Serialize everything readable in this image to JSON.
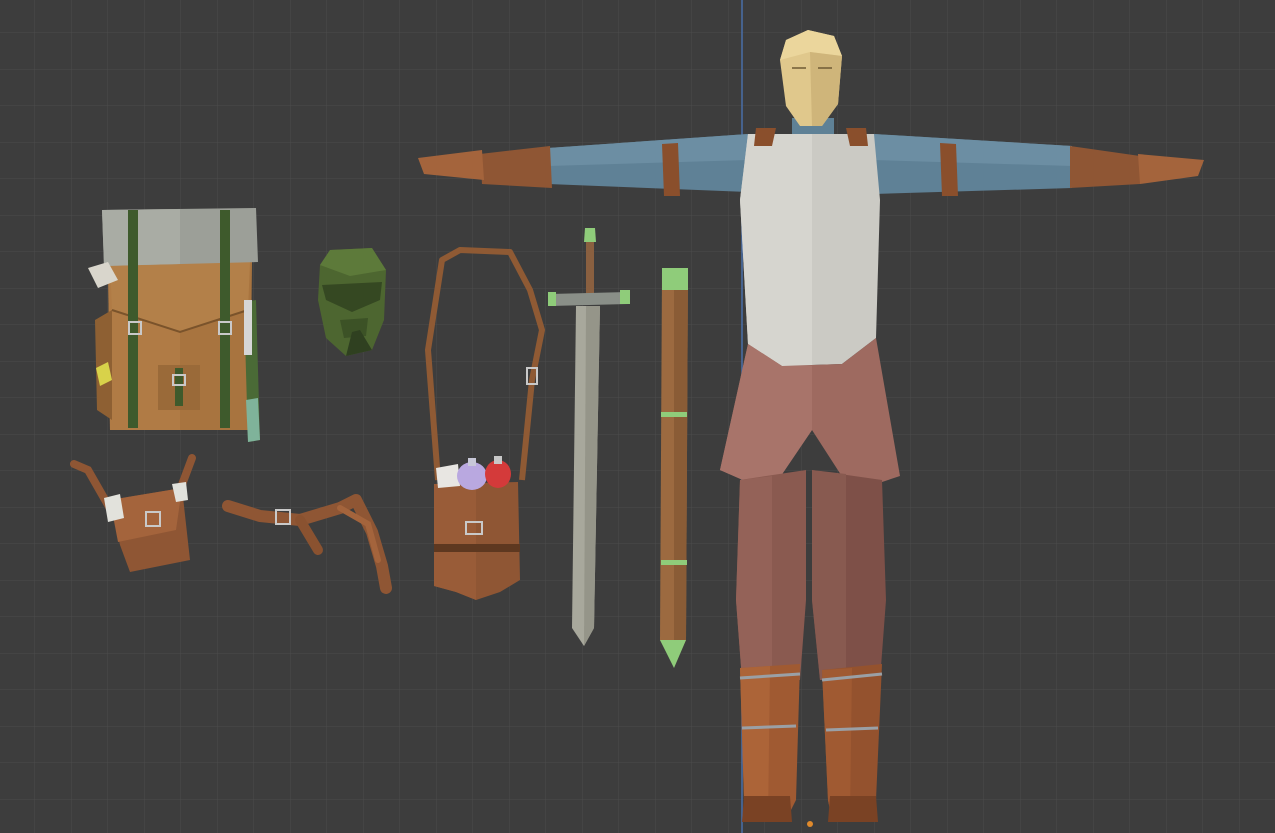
{
  "viewport": {
    "background_color": "#3d3d3d",
    "grid_color": "#4b4b4b",
    "vertical_axis_color": "#4a6ea8",
    "origin_color": "#e08a2c"
  },
  "assets": {
    "character": "character-model",
    "backpack": "backpack-model",
    "helmet": "helmet-model",
    "shoulder_bag": "shoulder-bag-model",
    "sword": "sword-model",
    "scabbard": "scabbard-model",
    "pouch": "belt-pouch-model",
    "belt": "belt-model"
  }
}
